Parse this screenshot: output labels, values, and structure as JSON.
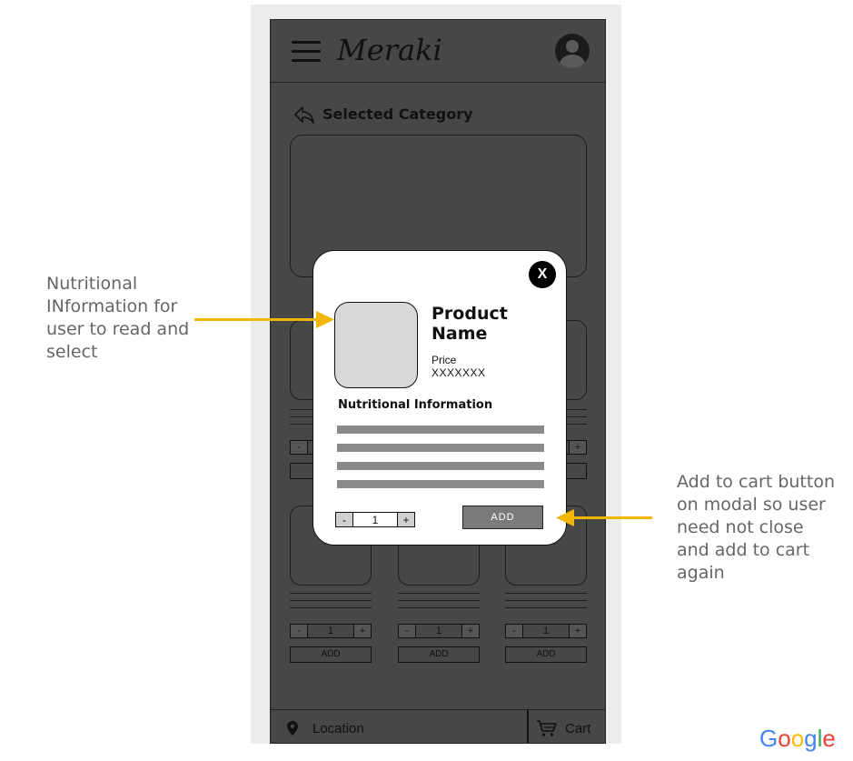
{
  "app": {
    "title": "Meraki"
  },
  "header": {
    "category_title": "Selected Category"
  },
  "product_cards": [
    {
      "qty": "1",
      "add_label": "ADD"
    },
    {
      "qty": "1",
      "add_label": "ADD"
    },
    {
      "qty": "1",
      "add_label": "ADD"
    }
  ],
  "bottom_bar": {
    "location_label": "Location",
    "cart_label": "Cart"
  },
  "modal": {
    "close_label": "X",
    "product_name": "Product Name",
    "price_label": "Price",
    "price_value": "XXXXXXX",
    "nutrition_title": "Nutritional Information",
    "qty_minus": "-",
    "qty_value": "1",
    "qty_plus": "+",
    "add_label": "ADD"
  },
  "annotations": {
    "left_note": "Nutritional INformation for user to read and select",
    "right_note": "Add to cart button on modal so user need not close and add to cart again"
  },
  "watermark": "Google",
  "colors": {
    "arrow": "#f2b705",
    "screen_overlay": "#474747"
  },
  "icons": [
    "menu-icon",
    "avatar-icon",
    "back-arrow-icon",
    "location-pin-icon",
    "cart-icon",
    "close-icon"
  ]
}
